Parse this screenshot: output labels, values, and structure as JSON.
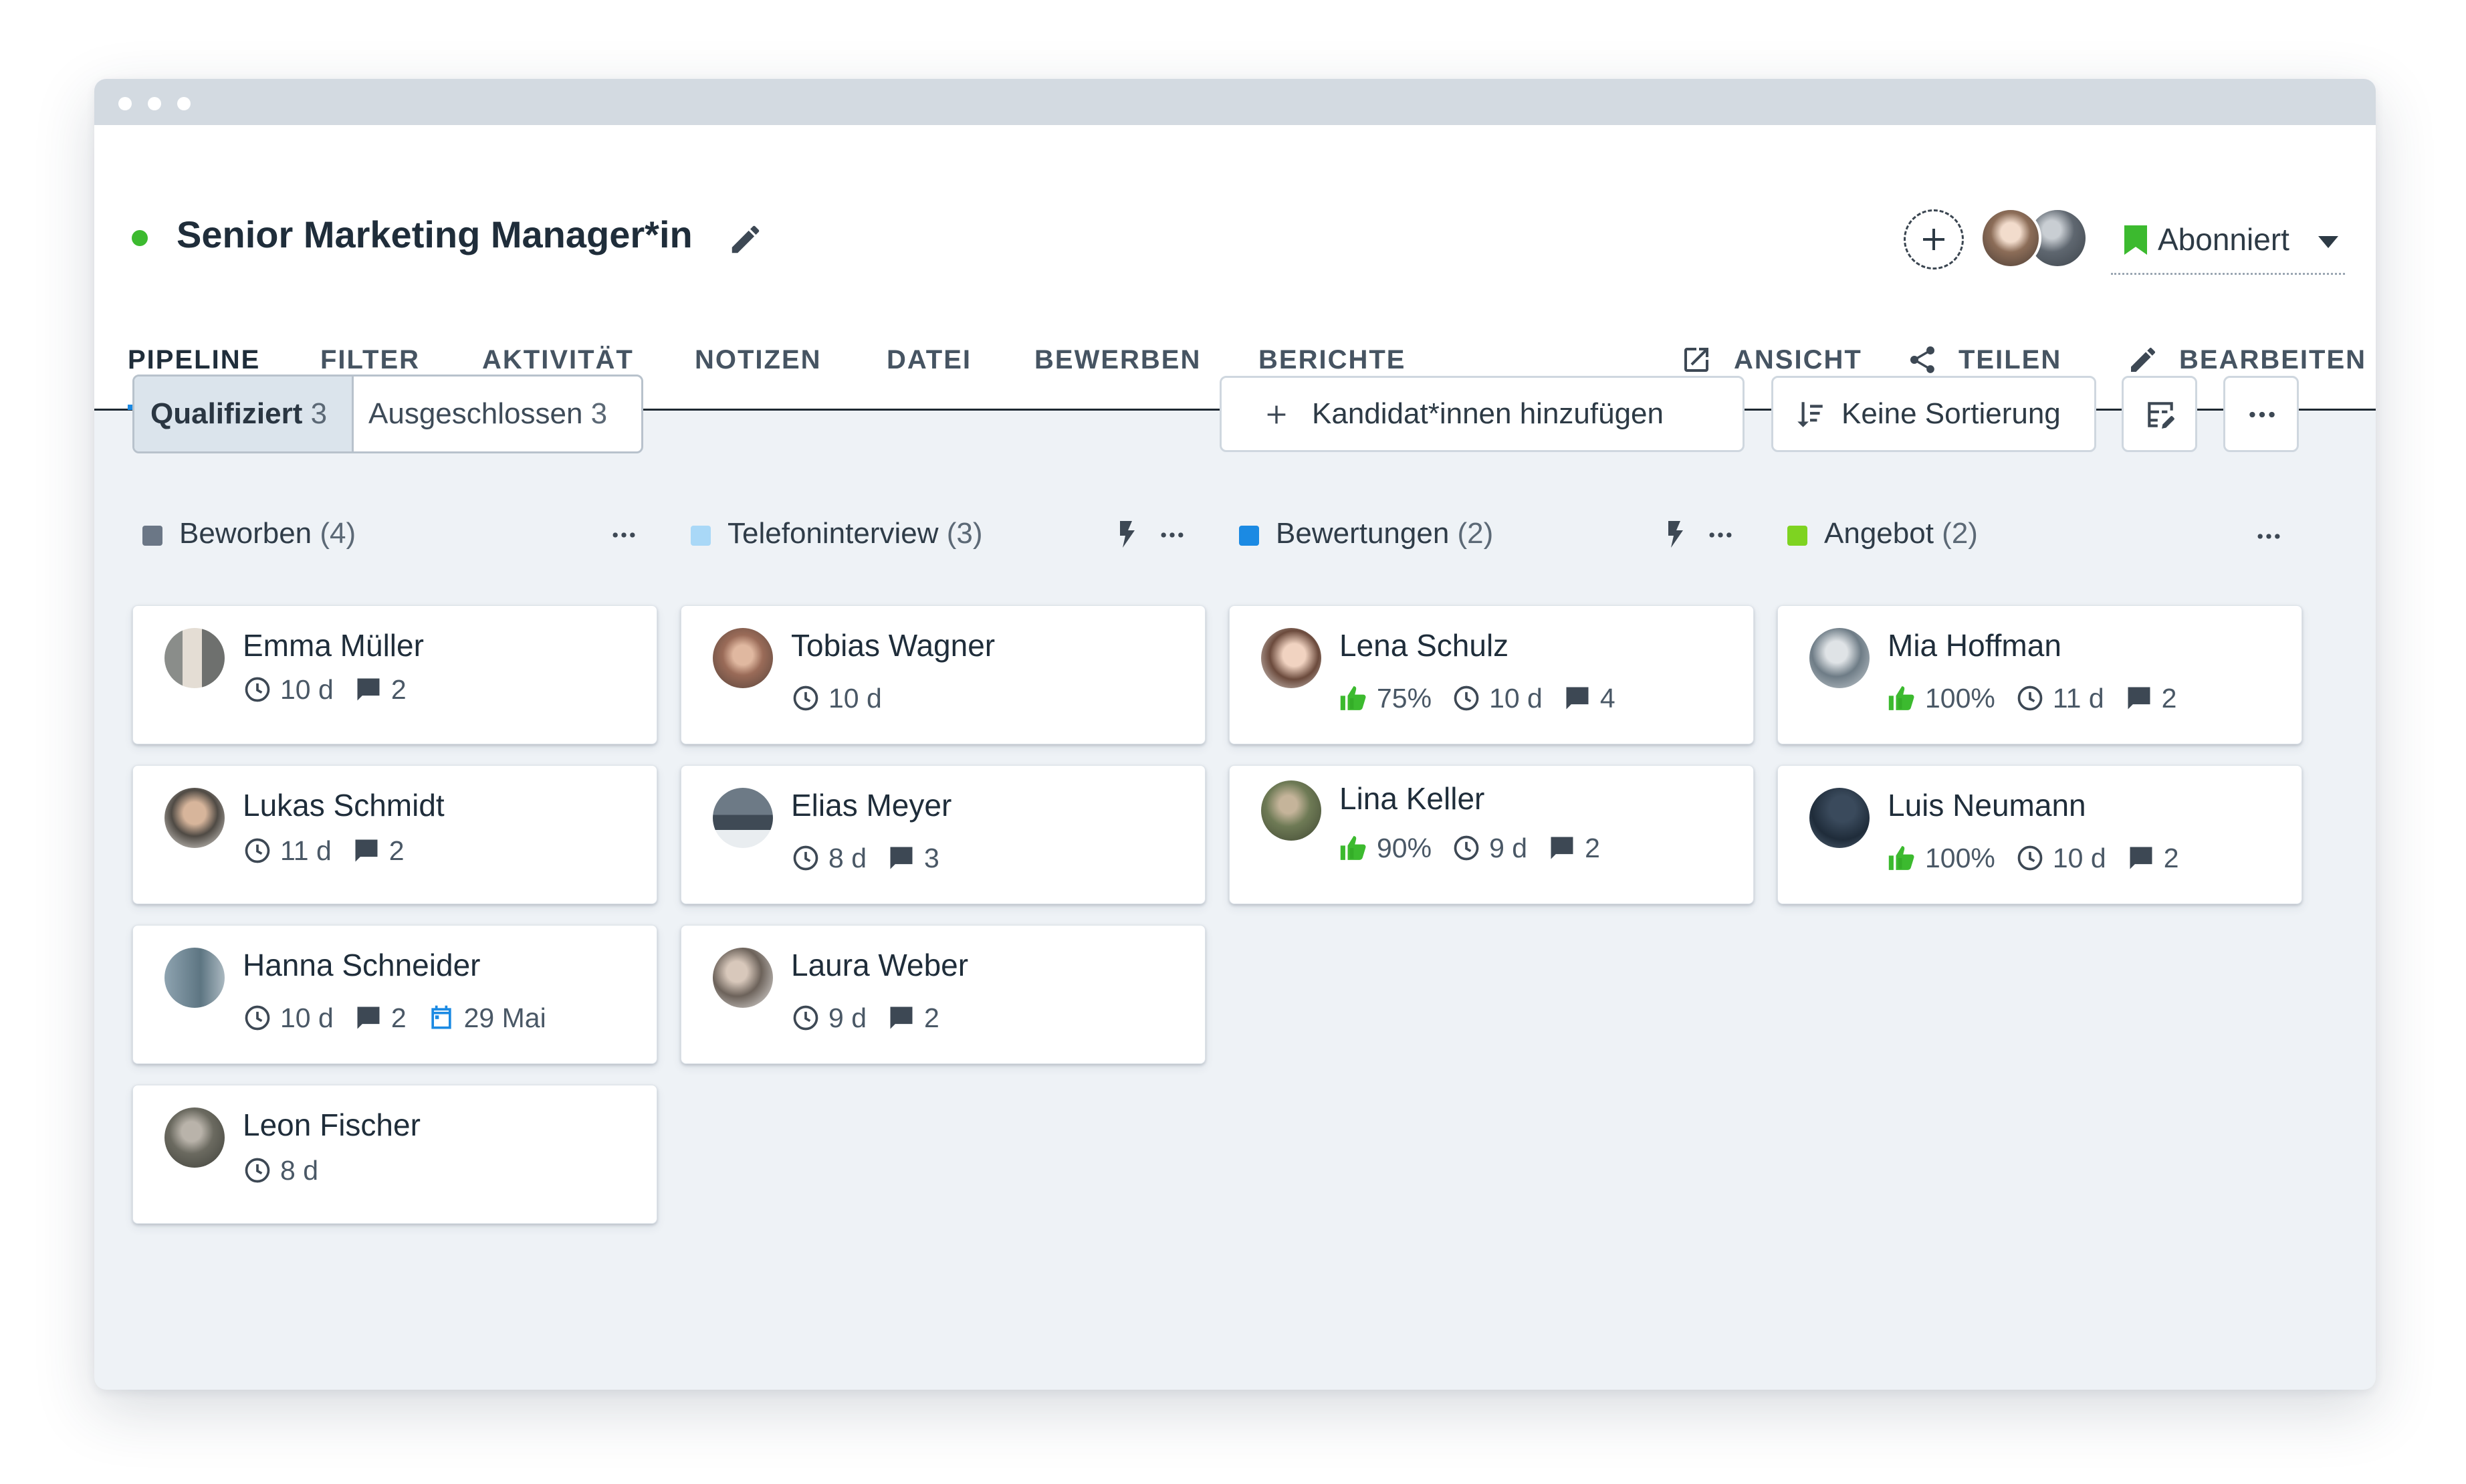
{
  "header": {
    "job_title": "Senior Marketing Manager*in",
    "status_color": "#3cba2f",
    "subscribe_label": "Abonniert"
  },
  "tabs": [
    {
      "label": "PIPELINE",
      "active": true
    },
    {
      "label": "FILTER"
    },
    {
      "label": "AKTIVITÄT"
    },
    {
      "label": "NOTIZEN"
    },
    {
      "label": "DATEI"
    },
    {
      "label": "BEWERBEN"
    },
    {
      "label": "BERICHTE"
    }
  ],
  "actions": [
    {
      "label": "ANSICHT",
      "icon": "external-link-icon"
    },
    {
      "label": "TEILEN",
      "icon": "share-icon"
    },
    {
      "label": "BEARBEITEN",
      "icon": "pencil-icon"
    }
  ],
  "toolbar": {
    "qualified_label": "Qualifiziert",
    "qualified_count": "3",
    "excluded_label": "Ausgeschlossen",
    "excluded_count": "3",
    "add_candidates_label": "Kandidat*innen hinzufügen",
    "sort_label": "Keine Sortierung"
  },
  "columns": [
    {
      "title": "Beworben",
      "count": "(4)",
      "color": "#6b7786",
      "cards": [
        {
          "name": "Emma Müller",
          "days": "10 d",
          "comments": "2"
        },
        {
          "name": "Lukas Schmidt",
          "days": "11 d",
          "comments": "2"
        },
        {
          "name": "Hanna Schneider",
          "days": "10 d",
          "comments": "2",
          "date": "29 Mai"
        },
        {
          "name": "Leon Fischer",
          "days": "8 d"
        }
      ]
    },
    {
      "title": "Telefoninterview",
      "count": "(3)",
      "color": "#a9d8f7",
      "cards": [
        {
          "name": "Tobias Wagner",
          "days": "10 d"
        },
        {
          "name": "Elias Meyer",
          "days": "8 d",
          "comments": "3"
        },
        {
          "name": "Laura Weber",
          "days": "9 d",
          "comments": "2"
        }
      ]
    },
    {
      "title": "Bewertungen",
      "count": "(2)",
      "color": "#1b8ae3",
      "cards": [
        {
          "name": "Lena Schulz",
          "score": "75%",
          "days": "10 d",
          "comments": "4"
        },
        {
          "name": "Lina Keller",
          "score": "90%",
          "days": "9 d",
          "comments": "2"
        }
      ]
    },
    {
      "title": "Angebot",
      "count": "(2)",
      "color": "#7ed321",
      "cards": [
        {
          "name": "Mia Hoffman",
          "score": "100%",
          "days": "11 d",
          "comments": "2"
        },
        {
          "name": "Luis Neumann",
          "score": "100%",
          "days": "10 d",
          "comments": "2"
        }
      ]
    }
  ]
}
